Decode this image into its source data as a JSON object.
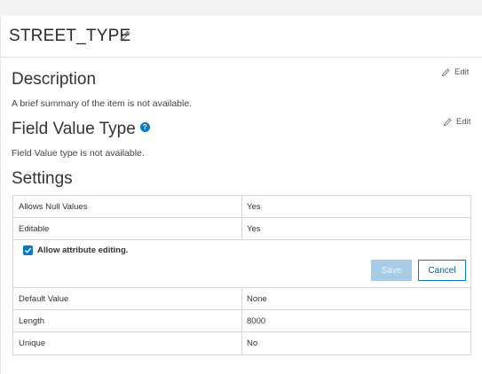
{
  "title": "STREET_TYPE",
  "description": {
    "heading": "Description",
    "text": "A brief summary of the item is not available.",
    "edit_label": "Edit"
  },
  "field_value_type": {
    "heading": "Field Value Type",
    "help": "?",
    "text": "Field Value type is not available.",
    "edit_label": "Edit"
  },
  "settings": {
    "heading": "Settings",
    "rows_top": [
      {
        "label": "Allows Null Values",
        "value": "Yes"
      },
      {
        "label": "Editable",
        "value": "Yes"
      }
    ],
    "allow_editing": {
      "label": "Allow attribute editing.",
      "checked": true
    },
    "save_label": "Save",
    "cancel_label": "Cancel",
    "rows_bottom": [
      {
        "label": "Default Value",
        "value": "None"
      },
      {
        "label": "Length",
        "value": "8000"
      },
      {
        "label": "Unique",
        "value": "No"
      }
    ]
  },
  "colors": {
    "accent": "#0a79c4",
    "save_disabled": "#a8cbe6"
  }
}
